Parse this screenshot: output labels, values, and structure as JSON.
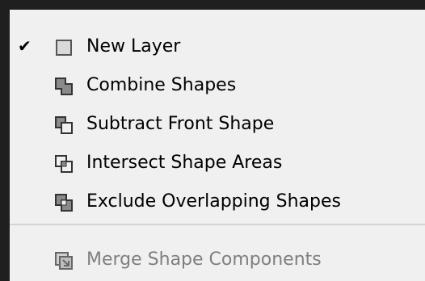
{
  "menu": {
    "items": [
      {
        "label": "New Layer",
        "icon": "new-layer-icon",
        "checked": true,
        "enabled": true
      },
      {
        "label": "Combine Shapes",
        "icon": "combine-shapes-icon",
        "checked": false,
        "enabled": true
      },
      {
        "label": "Subtract Front Shape",
        "icon": "subtract-front-shape-icon",
        "checked": false,
        "enabled": true
      },
      {
        "label": "Intersect Shape Areas",
        "icon": "intersect-shape-areas-icon",
        "checked": false,
        "enabled": true
      },
      {
        "label": "Exclude Overlapping Shapes",
        "icon": "exclude-overlapping-shapes-icon",
        "checked": false,
        "enabled": true
      },
      {
        "label": "Merge Shape Components",
        "icon": "merge-shape-components-icon",
        "checked": false,
        "enabled": false
      }
    ]
  },
  "colors": {
    "frame": "#1f1f1f",
    "menu_bg": "#f0f0f0",
    "text": "#000000",
    "disabled_text": "#7f7f7f",
    "separator": "#d4d4d4"
  }
}
